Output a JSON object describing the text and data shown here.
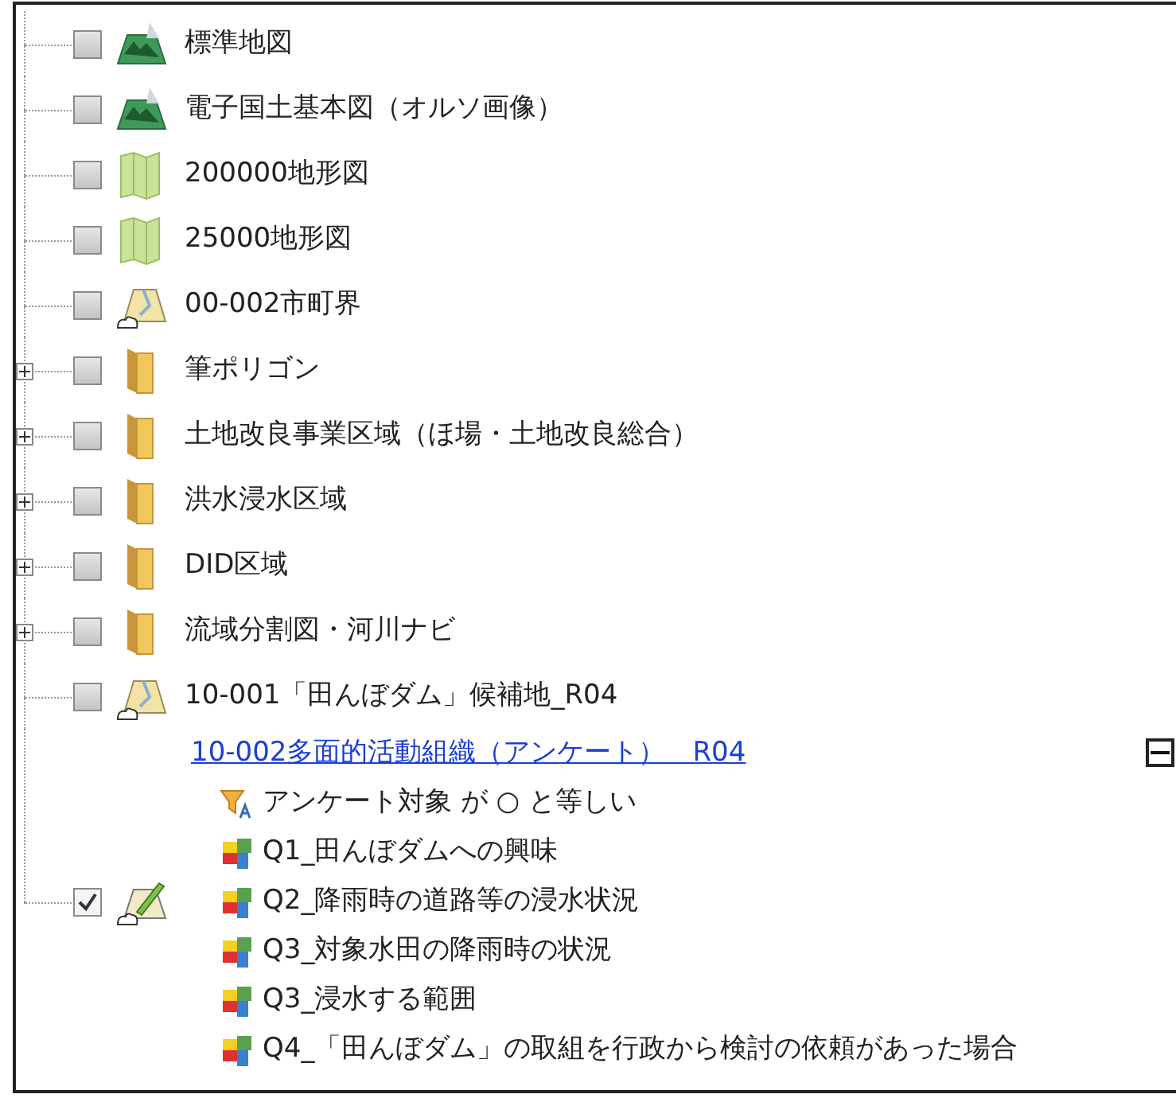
{
  "layers": [
    {
      "kind": "basemap",
      "label": "標準地図",
      "checked": false
    },
    {
      "kind": "basemap",
      "label": "電子国土基本図（オルソ画像）",
      "checked": false
    },
    {
      "kind": "map",
      "label": "200000地形図",
      "checked": false
    },
    {
      "kind": "map",
      "label": "25000地形図",
      "checked": false
    },
    {
      "kind": "vector",
      "label": "00-002市町界",
      "checked": false
    },
    {
      "kind": "folder",
      "label": "筆ポリゴン",
      "checked": false,
      "expanded": false
    },
    {
      "kind": "folder",
      "label": "土地改良事業区域（ほ場・土地改良総合）",
      "checked": false,
      "expanded": false
    },
    {
      "kind": "folder",
      "label": "洪水浸水区域",
      "checked": false,
      "expanded": false
    },
    {
      "kind": "folder",
      "label": "DID区域",
      "checked": false,
      "expanded": false
    },
    {
      "kind": "folder",
      "label": "流域分割図・河川ナビ",
      "checked": false,
      "expanded": false
    },
    {
      "kind": "vector",
      "label": "10-001「田んぼダム」候補地_R04",
      "checked": false
    },
    {
      "kind": "editable",
      "label": "10-002多面的活動組織（アンケート）　R04",
      "checked": true,
      "expanded": true,
      "legend": [
        {
          "kind": "filter",
          "label": "アンケート対象 が ○ と等しい"
        },
        {
          "kind": "symbol",
          "label": "Q1_田んぼダムへの興味"
        },
        {
          "kind": "symbol",
          "label": "Q2_降雨時の道路等の浸水状況"
        },
        {
          "kind": "symbol",
          "label": "Q3_対象水田の降雨時の状況"
        },
        {
          "kind": "symbol",
          "label": "Q3_浸水する範囲"
        },
        {
          "kind": "symbol",
          "label": "Q4_「田んぼダム」の取組を行政から検討の依頼があった場合"
        }
      ]
    }
  ]
}
